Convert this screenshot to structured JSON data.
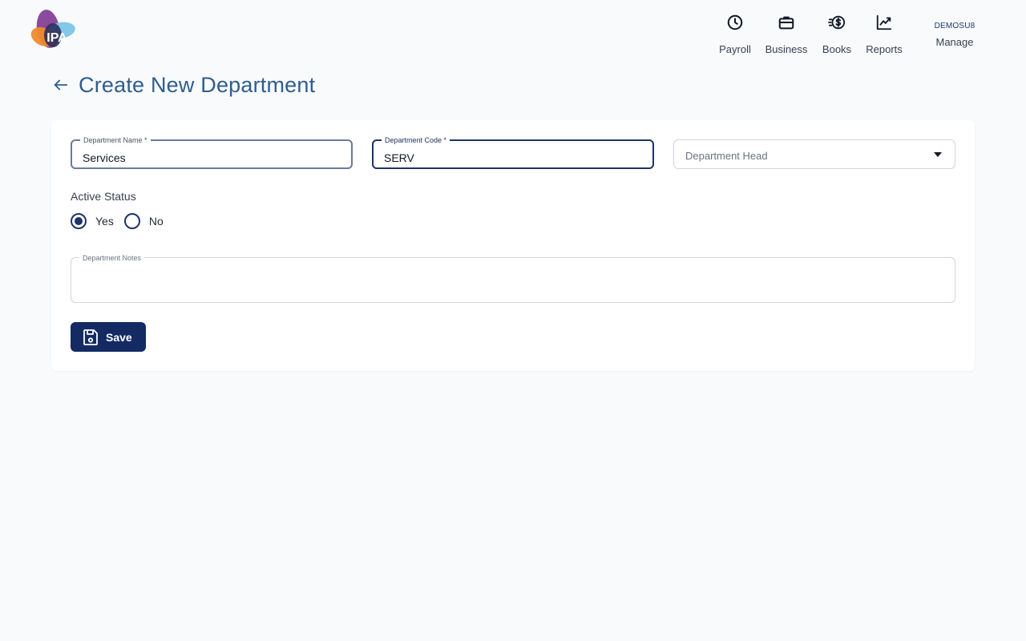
{
  "header": {
    "logo_text": "IPA",
    "nav": [
      {
        "label": "Payroll",
        "icon": "clock-icon"
      },
      {
        "label": "Business",
        "icon": "briefcase-icon"
      },
      {
        "label": "Books",
        "icon": "dollar-coin-icon"
      },
      {
        "label": "Reports",
        "icon": "chart-line-icon"
      }
    ],
    "user": {
      "code": "DEMOSU8",
      "label": "Manage"
    }
  },
  "page": {
    "title": "Create New Department",
    "back_icon": "arrow-left-icon"
  },
  "form": {
    "department_name": {
      "label": "Department Name *",
      "value": "Services"
    },
    "department_code": {
      "label": "Department Code *",
      "value": "SERV"
    },
    "department_head": {
      "placeholder": "Department Head"
    },
    "active_status": {
      "label": "Active Status",
      "options": [
        {
          "label": "Yes",
          "selected": true
        },
        {
          "label": "No",
          "selected": false
        }
      ]
    },
    "department_notes": {
      "label": "Department Notes",
      "value": ""
    },
    "save_label": "Save"
  },
  "colors": {
    "primary": "#132a63",
    "title": "#2f5d8f",
    "background": "#f8fafc",
    "card": "#ffffff"
  }
}
